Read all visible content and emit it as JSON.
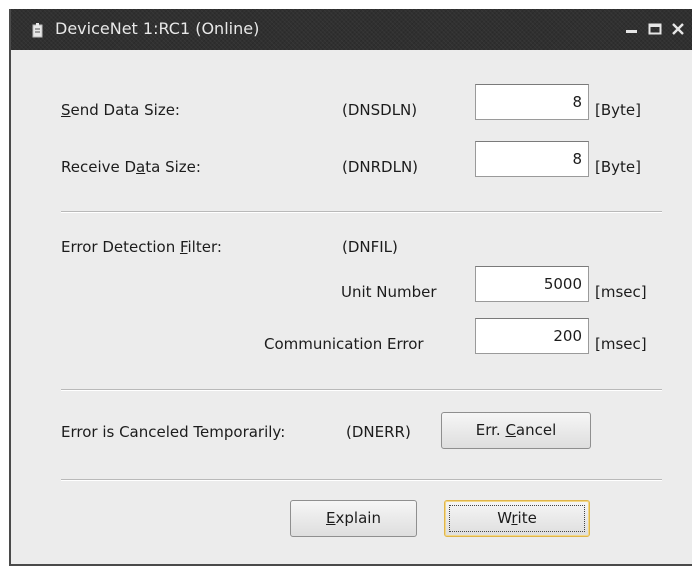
{
  "window": {
    "title": "DeviceNet 1:RC1 (Online)",
    "controls": {
      "minimize": "minimize-icon",
      "maximize": "maximize-icon",
      "close": "close-icon"
    }
  },
  "send": {
    "key": "S",
    "rest": "end Data Size:",
    "code": "(DNSDLN)",
    "value": "8",
    "unit": "[Byte]"
  },
  "receive": {
    "pre": "Receive D",
    "key": "a",
    "post": "ta Size:",
    "code": "(DNRDLN)",
    "value": "8",
    "unit": "[Byte]"
  },
  "filter": {
    "pre": "Error Detection ",
    "key": "F",
    "post": "ilter:",
    "code": "(DNFIL)",
    "unit_number_label": "Unit Number",
    "unit_number_value": "5000",
    "unit_number_unit": "[msec]",
    "comm_error_label": "Communication Error",
    "comm_error_value": "200",
    "comm_error_unit": "[msec]"
  },
  "cancel": {
    "label": "Error is Canceled Temporarily:",
    "code": "(DNERR)",
    "button_pre": "Err. ",
    "button_key": "C",
    "button_post": "ancel"
  },
  "actions": {
    "explain_key": "E",
    "explain_rest": "xplain",
    "write_pre": "W",
    "write_key": "r",
    "write_post": "ite"
  },
  "colors": {
    "titlebar": "#303030",
    "dialog_bg": "#ececec",
    "default_button_border": "#e0b54a"
  }
}
